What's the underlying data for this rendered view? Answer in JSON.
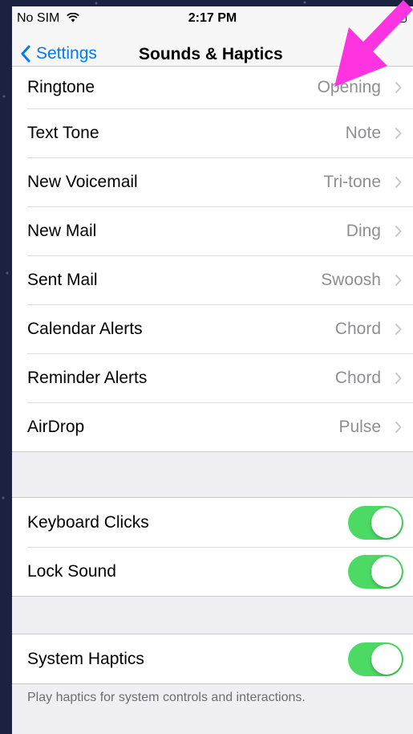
{
  "status_bar": {
    "carrier": "No SIM",
    "time": "2:17 PM",
    "wifi_icon": "wifi-icon",
    "battery_icon": "battery-icon"
  },
  "nav": {
    "back_label": "Settings",
    "title": "Sounds & Haptics"
  },
  "sounds": [
    {
      "label": "Ringtone",
      "value": "Opening"
    },
    {
      "label": "Text Tone",
      "value": "Note"
    },
    {
      "label": "New Voicemail",
      "value": "Tri-tone"
    },
    {
      "label": "New Mail",
      "value": "Ding"
    },
    {
      "label": "Sent Mail",
      "value": "Swoosh"
    },
    {
      "label": "Calendar Alerts",
      "value": "Chord"
    },
    {
      "label": "Reminder Alerts",
      "value": "Chord"
    },
    {
      "label": "AirDrop",
      "value": "Pulse"
    }
  ],
  "feedback": [
    {
      "label": "Keyboard Clicks",
      "on": true
    },
    {
      "label": "Lock Sound",
      "on": true
    }
  ],
  "haptics": {
    "label": "System Haptics",
    "on": true,
    "footer": "Play haptics for system controls and interactions."
  },
  "colors": {
    "accent": "#007aff",
    "toggle_on": "#4cd964",
    "annotation_arrow": "#ff33e0"
  }
}
